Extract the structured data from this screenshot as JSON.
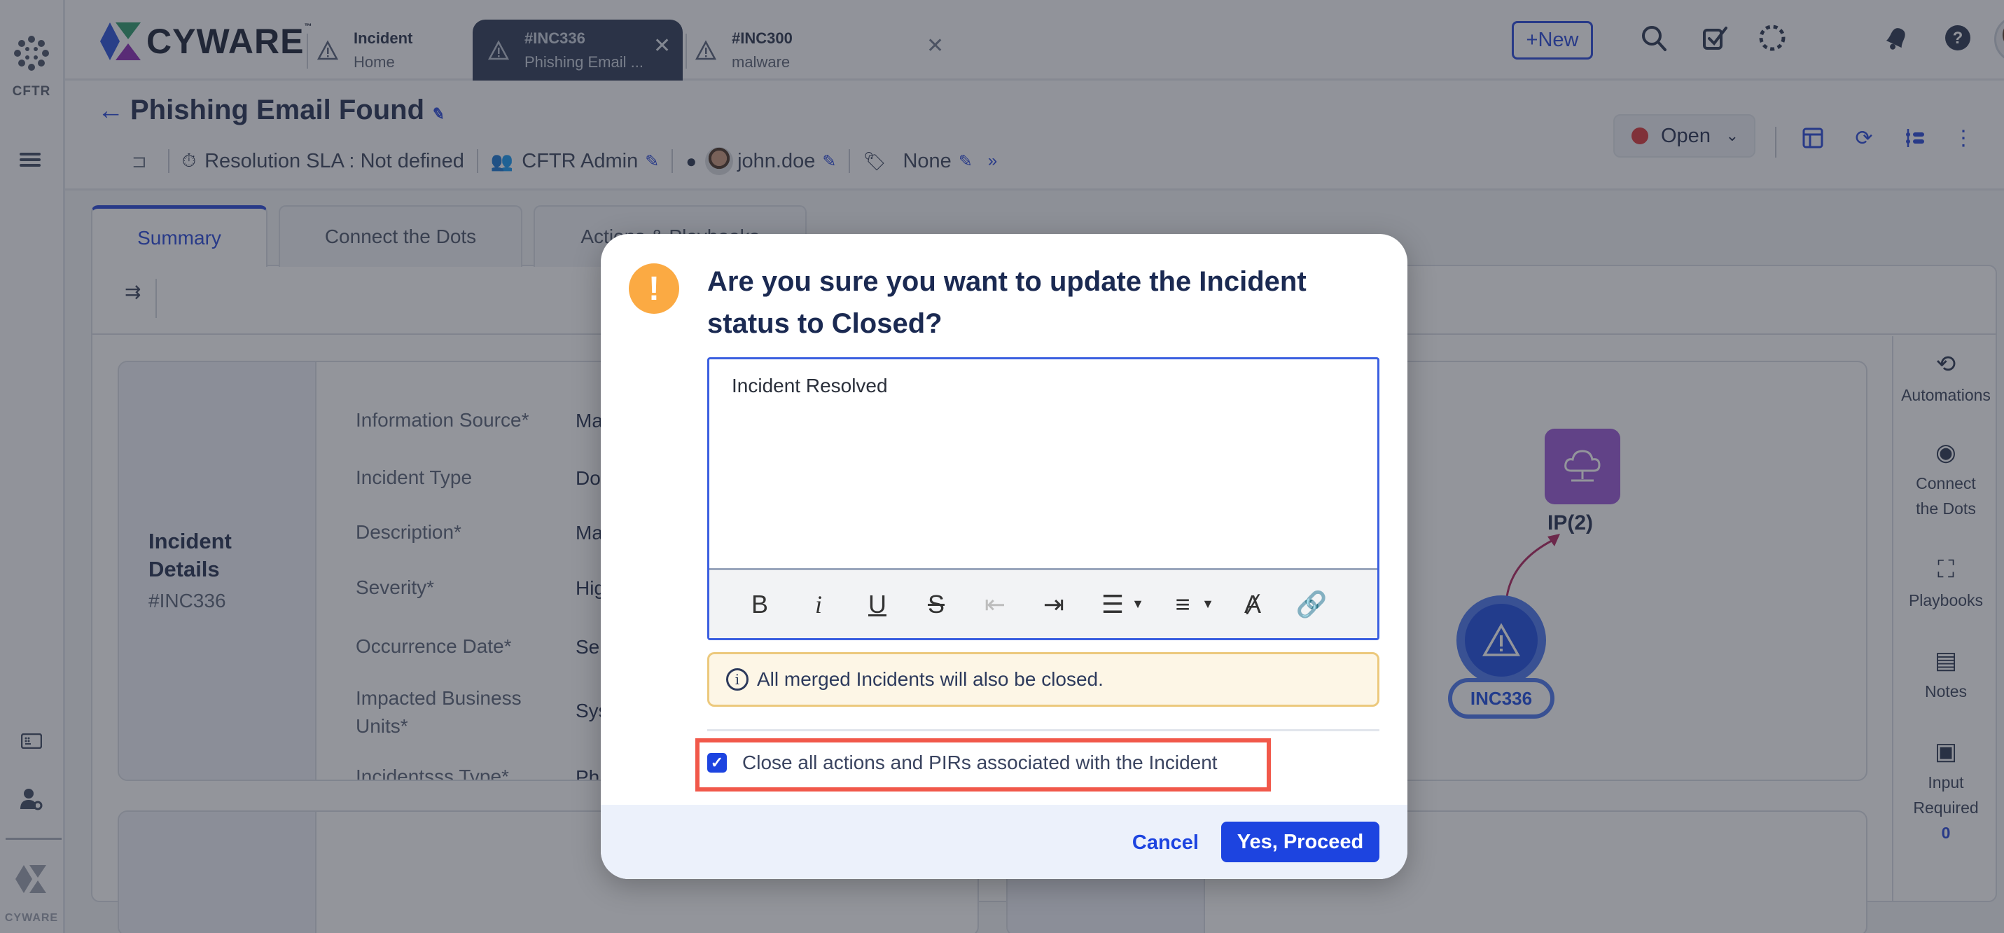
{
  "rail": {
    "brand_label": "CFTR",
    "footer_label": "CYWARE"
  },
  "topbar": {
    "logo_text": "CYWARE",
    "logo_tm": "™",
    "tabs": [
      {
        "line1": "Incident",
        "line2": "Home",
        "active": false,
        "closable": false
      },
      {
        "line1": "#INC336",
        "line2": "Phishing Email ...",
        "active": true,
        "closable": true
      },
      {
        "line1": "#INC300",
        "line2": "malware",
        "active": false,
        "closable": true
      }
    ],
    "close_glyph": "✕",
    "new_button": "+New",
    "icons": [
      "search-icon",
      "tasks-check-icon",
      "loading-icon",
      "notification-bell-icon",
      "help-icon",
      "user-avatar"
    ]
  },
  "incident": {
    "title": "Phishing Email Found",
    "sla_label": "Resolution SLA :",
    "sla_value": "Not defined",
    "group": "CFTR Admin",
    "assignee": "john.doe",
    "tags": "None",
    "status": "Open",
    "status_color": "#d9363a"
  },
  "tabs": [
    {
      "label": "Summary",
      "active": true
    },
    {
      "label": "Connect the Dots",
      "active": false
    },
    {
      "label": "Actions & Playbooks",
      "active": false
    }
  ],
  "details_card": {
    "title": "Incident Details",
    "id": "#INC336",
    "fields": [
      {
        "label": "Information Source*",
        "value": "Ma"
      },
      {
        "label": "Incident Type",
        "value": "Do"
      },
      {
        "label": "Description*",
        "value": "Ma"
      },
      {
        "label": "Severity*",
        "value": "Hig"
      },
      {
        "label": "Occurrence Date*",
        "value": "Sep"
      },
      {
        "label": "Impacted Business Units*",
        "value": "Sys"
      },
      {
        "label": "Incidentsss Type*",
        "value": "Phi"
      }
    ]
  },
  "graph": {
    "ip_node_label": "IP(2)",
    "incident_node_label": "INC336"
  },
  "right_rail": [
    {
      "label": "Automations",
      "icon": "automation-icon"
    },
    {
      "label": "Connect the Dots",
      "icon": "connect-dots-icon"
    },
    {
      "label": "Playbooks",
      "icon": "playbook-icon"
    },
    {
      "label": "Notes",
      "icon": "notes-icon"
    },
    {
      "label": "Input Required",
      "icon": "input-required-icon",
      "count": "0"
    }
  ],
  "modal": {
    "title": "Are you sure you want to update the Incident status to Closed?",
    "editor_value": "Incident Resolved",
    "toolbar": [
      "bold",
      "italic",
      "underline",
      "strikethrough",
      "outdent",
      "indent",
      "ordered-list",
      "bullet-list",
      "clear-format",
      "link"
    ],
    "notice": "All merged Incidents will also be closed.",
    "checkbox_label": "Close all actions and PIRs associated with the Incident",
    "checkbox_checked": true,
    "cancel": "Cancel",
    "proceed": "Yes, Proceed"
  }
}
